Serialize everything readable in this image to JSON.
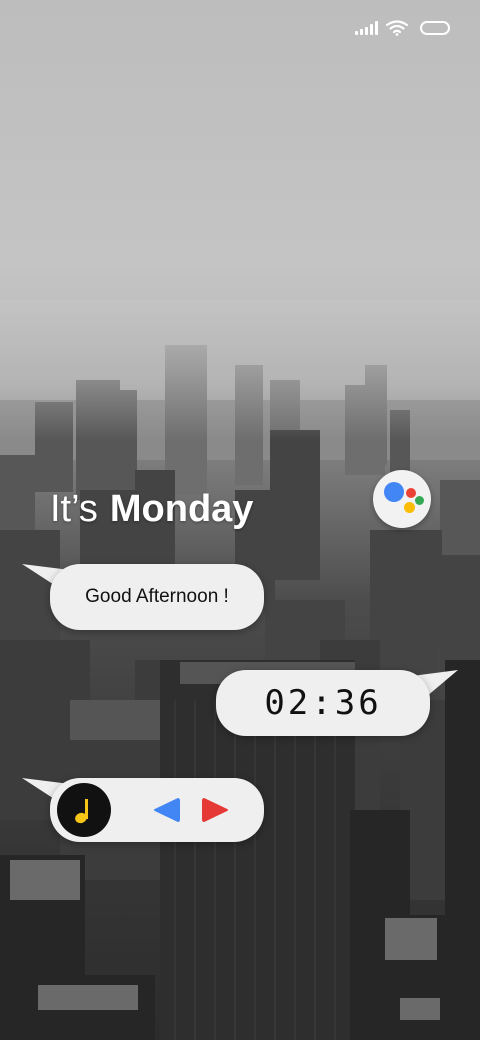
{
  "status_bar": {
    "icons": [
      "signal-icon",
      "wifi-icon",
      "battery-icon"
    ]
  },
  "greeting_header": {
    "prefix": "It’s",
    "day": "Monday"
  },
  "assistant": {
    "icon": "google-assistant-icon",
    "colors": [
      "#4285F4",
      "#EA4335",
      "#FBBC05",
      "#34A853"
    ]
  },
  "greeting_bubble": {
    "text": "Good Afternoon !"
  },
  "clock_bubble": {
    "time": "02:36"
  },
  "music_bubble": {
    "icons": [
      "music-note-icon",
      "previous-icon",
      "next-icon"
    ],
    "colors": {
      "note": "#F5C518",
      "previous": "#4285F4",
      "next": "#E53935"
    }
  },
  "theme": {
    "bubble_background": "#EFEFEF",
    "text_color": "#111111"
  }
}
